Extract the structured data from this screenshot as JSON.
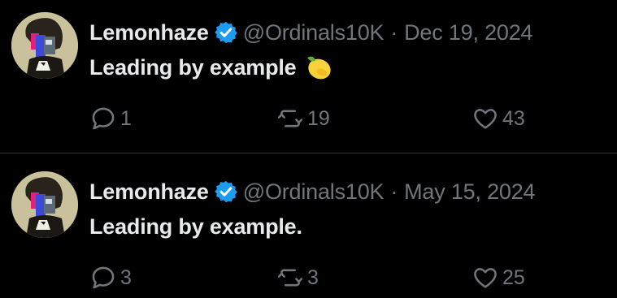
{
  "colors": {
    "background": "#000000",
    "primary_text": "#e7e9ea",
    "secondary_text": "#71767b",
    "divider": "#2f3336",
    "verified_badge": "#1d9bf0"
  },
  "tweets": [
    {
      "author_name": "Lemonhaze",
      "verified_icon": "verified-badge-icon",
      "handle": "@Ordinals10K",
      "separator": "·",
      "date": "Dec 19, 2024",
      "text": "Leading by example",
      "emoji_icon": "lemon-icon",
      "replies": "1",
      "reposts": "19",
      "likes": "43"
    },
    {
      "author_name": "Lemonhaze",
      "verified_icon": "verified-badge-icon",
      "handle": "@Ordinals10K",
      "separator": "·",
      "date": "May 15, 2024",
      "text": "Leading by example.",
      "replies": "3",
      "reposts": "3",
      "likes": "25"
    }
  ]
}
